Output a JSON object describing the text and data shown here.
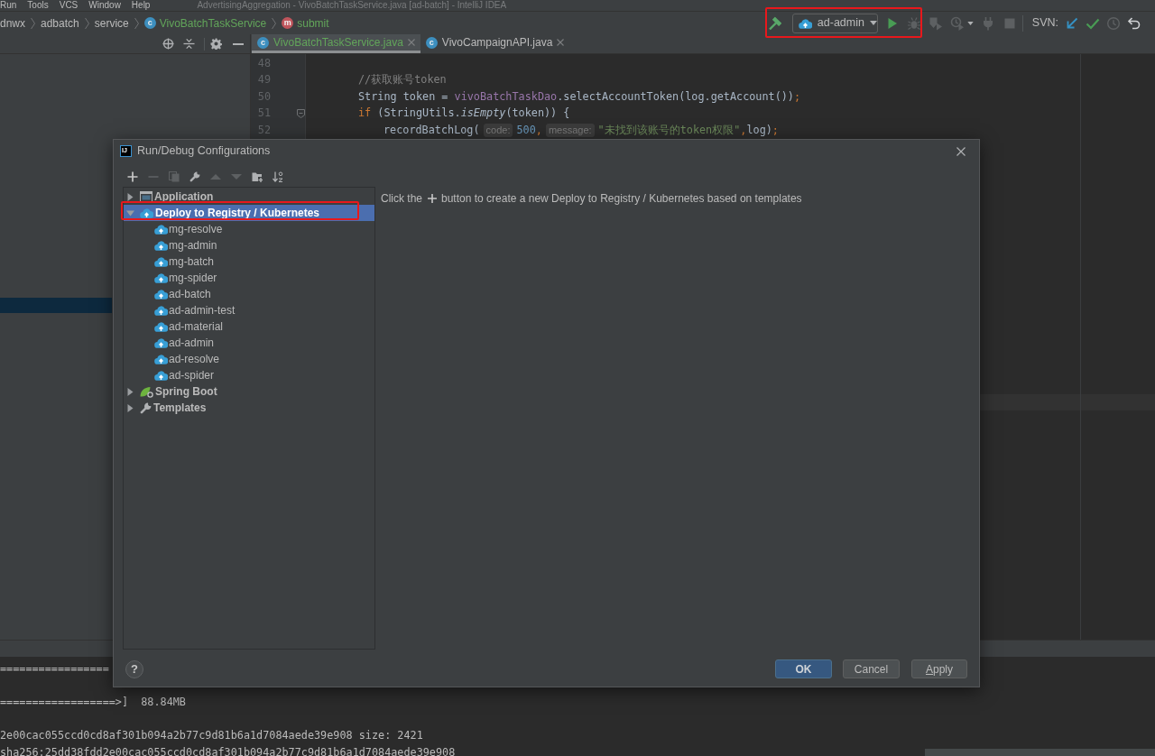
{
  "window": {
    "title": "AdvertisingAggregation - VivoBatchTaskService.java [ad-batch] - IntelliJ IDEA"
  },
  "menu": [
    "Run",
    "Tools",
    "VCS",
    "Window",
    "Help"
  ],
  "breadcrumbs": [
    {
      "kind": "package",
      "label": "dnwx",
      "modified": false
    },
    {
      "kind": "package",
      "label": "adbatch",
      "modified": false
    },
    {
      "kind": "package",
      "label": "service",
      "modified": false
    },
    {
      "kind": "class",
      "label": "VivoBatchTaskService",
      "badge": "c",
      "modified": true
    },
    {
      "kind": "method",
      "label": "submit",
      "badge": "m",
      "modified": true
    }
  ],
  "toolbar": {
    "run_group": {
      "highlighted": true,
      "config": "ad-admin",
      "actions": [
        {
          "kind": "run",
          "disabled": false
        },
        {
          "kind": "debug",
          "disabled": true
        }
      ]
    },
    "actions": [
      {
        "kind": "coverage",
        "disabled": true
      },
      {
        "kind": "profile",
        "disabled": true
      },
      {
        "kind": "attach",
        "disabled": true
      },
      {
        "kind": "stop",
        "disabled": true
      }
    ],
    "vcs_label": "SVN:",
    "vcs_actions": [
      {
        "kind": "update",
        "disabled": false
      },
      {
        "kind": "commit",
        "disabled": false
      },
      {
        "kind": "history",
        "disabled": true
      },
      {
        "kind": "rollback",
        "disabled": false
      }
    ]
  },
  "editor_tabs": [
    {
      "label": "VivoBatchTaskService.java",
      "badge": "c",
      "selected": true,
      "modified": true
    },
    {
      "label": "VivoCampaignAPI.java",
      "badge": "c",
      "selected": false,
      "modified": false
    }
  ],
  "editor": {
    "lines": [
      {
        "number": "48",
        "foldable": false
      },
      {
        "number": "49",
        "foldable": false,
        "segments": [
          {
            "kind": "comment",
            "text": "//获取账号token"
          }
        ]
      },
      {
        "number": "50",
        "foldable": false,
        "segments": [
          {
            "kind": "plain",
            "text": "String token = "
          },
          {
            "kind": "field",
            "text": "vivoBatchTaskDao"
          },
          {
            "kind": "plain",
            "text": ".selectAccountToken(log.getAccount())"
          },
          {
            "kind": "punct",
            "text": ";"
          }
        ]
      },
      {
        "number": "51",
        "foldable": true,
        "segments": [
          {
            "kind": "keyword",
            "text": "if"
          },
          {
            "kind": "plain",
            "text": " (StringUtils."
          },
          {
            "kind": "static_call",
            "text": "isEmpty"
          },
          {
            "kind": "plain",
            "text": "(token)) {"
          }
        ],
        "children": [
          {
            "number": "52",
            "foldable": false,
            "segments": [
              {
                "kind": "plain",
                "text": "recordBatchLog("
              },
              {
                "kind": "hint",
                "text": "code:"
              },
              {
                "kind": "number",
                "text": "500"
              },
              {
                "kind": "punct",
                "text": ","
              },
              {
                "kind": "hint",
                "text": "message:"
              },
              {
                "kind": "string",
                "text": "\"未找到该账号的token权限\""
              },
              {
                "kind": "punct",
                "text": ","
              },
              {
                "kind": "plain",
                "text": "log)"
              },
              {
                "kind": "punct",
                "text": ";"
              }
            ]
          }
        ]
      }
    ]
  },
  "console": {
    "lines": [
      {
        "kind": "text",
        "text": "================="
      },
      {
        "kind": "blank"
      },
      {
        "kind": "text",
        "text": "==================>]  88.84MB"
      },
      {
        "kind": "blank"
      },
      {
        "kind": "text",
        "text": "2e00cac055ccd0cd8af301b094a2b77c9d81b6a1d7084aede39e908 size: 2421"
      },
      {
        "kind": "text",
        "text": "sha256:25dd38fdd2e00cac055ccd0cd8af301b094a2b77c9d81b6a1d7084aede39e908"
      }
    ]
  },
  "dialog": {
    "logo": "IJ",
    "title": "Run/Debug Configurations",
    "toolbar": [
      {
        "kind": "add",
        "disabled": false
      },
      {
        "kind": "remove",
        "disabled": true
      },
      {
        "kind": "copy",
        "disabled": true
      },
      {
        "kind": "edit",
        "disabled": false
      },
      {
        "kind": "move_up",
        "disabled": true
      },
      {
        "kind": "move_down",
        "disabled": true
      },
      {
        "kind": "folder",
        "disabled": false
      },
      {
        "kind": "sort",
        "disabled": false
      }
    ],
    "tree": [
      {
        "label": "Application",
        "kind": "application",
        "expanded": false,
        "selected": false,
        "highlighted": false
      },
      {
        "label": "Deploy to Registry / Kubernetes",
        "kind": "deploy",
        "expanded": true,
        "selected": true,
        "highlighted": true,
        "children": [
          {
            "label": "mg-resolve",
            "kind": "deploy",
            "selected": false
          },
          {
            "label": "mg-admin",
            "kind": "deploy",
            "selected": false
          },
          {
            "label": "mg-batch",
            "kind": "deploy",
            "selected": false
          },
          {
            "label": "mg-spider",
            "kind": "deploy",
            "selected": false
          },
          {
            "label": "ad-batch",
            "kind": "deploy",
            "selected": false
          },
          {
            "label": "ad-admin-test",
            "kind": "deploy",
            "selected": false
          },
          {
            "label": "ad-material",
            "kind": "deploy",
            "selected": false
          },
          {
            "label": "ad-admin",
            "kind": "deploy",
            "selected": false
          },
          {
            "label": "ad-resolve",
            "kind": "deploy",
            "selected": false
          },
          {
            "label": "ad-spider",
            "kind": "deploy",
            "selected": false
          }
        ]
      },
      {
        "label": "Spring Boot",
        "kind": "spring",
        "expanded": false,
        "selected": false,
        "highlighted": false
      },
      {
        "label": "Templates",
        "kind": "templates",
        "expanded": false,
        "selected": false,
        "highlighted": false
      }
    ],
    "hint": {
      "before": "Click the",
      "after": "button to create a new Deploy to Registry / Kubernetes based on templates"
    },
    "help": "?",
    "buttons": [
      {
        "label": "OK",
        "kind": "primary",
        "mnemonic": false
      },
      {
        "label": "Cancel",
        "kind": "secondary",
        "mnemonic": false
      },
      {
        "label": "Apply",
        "kind": "secondary",
        "mnemonic": true
      }
    ]
  }
}
